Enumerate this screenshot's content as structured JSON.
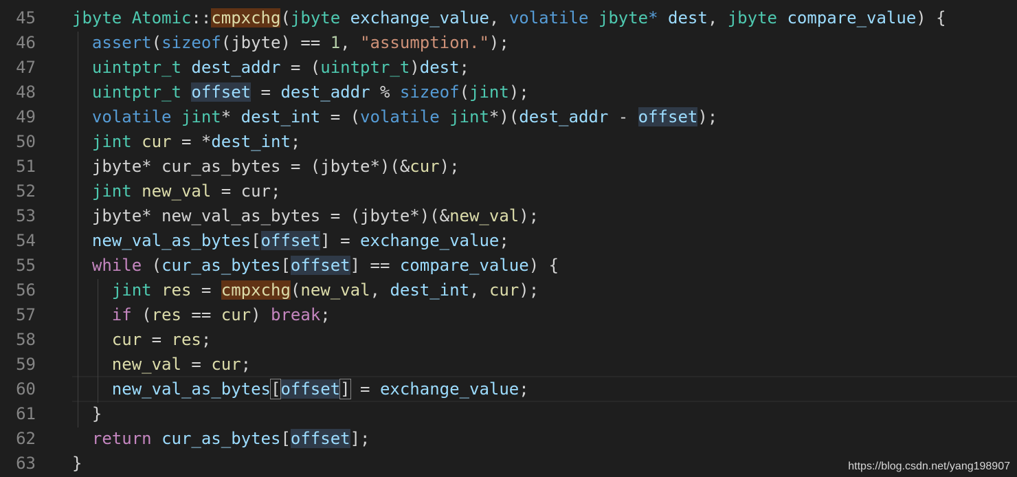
{
  "editor": {
    "lines": [
      {
        "num": "45",
        "tokens": [
          {
            "text": "jbyte ",
            "cls": "t-type"
          },
          {
            "text": "Atomic",
            "cls": "t-type"
          },
          {
            "text": "::",
            "cls": "t-plain"
          },
          {
            "text": "cmpxchg",
            "cls": "t-fn",
            "hl": "hl-sym"
          },
          {
            "text": "(",
            "cls": "t-plain"
          },
          {
            "text": "jbyte ",
            "cls": "t-type"
          },
          {
            "text": "exchange_value",
            "cls": "t-var"
          },
          {
            "text": ", ",
            "cls": "t-plain"
          },
          {
            "text": "volatile ",
            "cls": "t-kw"
          },
          {
            "text": "jbyte",
            "cls": "t-type"
          },
          {
            "text": "* ",
            "cls": "t-kw"
          },
          {
            "text": "dest",
            "cls": "t-var"
          },
          {
            "text": ", ",
            "cls": "t-plain"
          },
          {
            "text": "jbyte ",
            "cls": "t-type"
          },
          {
            "text": "compare_value",
            "cls": "t-var"
          },
          {
            "text": ") {",
            "cls": "t-plain"
          }
        ]
      },
      {
        "num": "46",
        "tokens": [
          {
            "text": "  ",
            "cls": "t-plain"
          },
          {
            "text": "assert",
            "cls": "t-kw"
          },
          {
            "text": "(",
            "cls": "t-plain"
          },
          {
            "text": "sizeof",
            "cls": "t-kw"
          },
          {
            "text": "(jbyte) == ",
            "cls": "t-plain"
          },
          {
            "text": "1",
            "cls": "t-num"
          },
          {
            "text": ", ",
            "cls": "t-plain"
          },
          {
            "text": "\"assumption.\"",
            "cls": "t-str"
          },
          {
            "text": ");",
            "cls": "t-plain"
          }
        ]
      },
      {
        "num": "47",
        "tokens": [
          {
            "text": "  ",
            "cls": "t-plain"
          },
          {
            "text": "uintptr_t ",
            "cls": "t-type"
          },
          {
            "text": "dest_addr",
            "cls": "t-var"
          },
          {
            "text": " = (",
            "cls": "t-plain"
          },
          {
            "text": "uintptr_t",
            "cls": "t-type"
          },
          {
            "text": ")",
            "cls": "t-plain"
          },
          {
            "text": "dest",
            "cls": "t-var"
          },
          {
            "text": ";",
            "cls": "t-plain"
          }
        ]
      },
      {
        "num": "48",
        "tokens": [
          {
            "text": "  ",
            "cls": "t-plain"
          },
          {
            "text": "uintptr_t ",
            "cls": "t-type"
          },
          {
            "text": "offset",
            "cls": "t-var",
            "hl": "hl-word"
          },
          {
            "text": " = ",
            "cls": "t-plain"
          },
          {
            "text": "dest_addr",
            "cls": "t-var"
          },
          {
            "text": " % ",
            "cls": "t-plain"
          },
          {
            "text": "sizeof",
            "cls": "t-kw"
          },
          {
            "text": "(",
            "cls": "t-plain"
          },
          {
            "text": "jint",
            "cls": "t-type"
          },
          {
            "text": ");",
            "cls": "t-plain"
          }
        ]
      },
      {
        "num": "49",
        "tokens": [
          {
            "text": "  ",
            "cls": "t-plain"
          },
          {
            "text": "volatile ",
            "cls": "t-kw"
          },
          {
            "text": "jint",
            "cls": "t-type"
          },
          {
            "text": "* ",
            "cls": "t-plain"
          },
          {
            "text": "dest_int",
            "cls": "t-var"
          },
          {
            "text": " = (",
            "cls": "t-plain"
          },
          {
            "text": "volatile ",
            "cls": "t-kw"
          },
          {
            "text": "jint",
            "cls": "t-type"
          },
          {
            "text": "*)(",
            "cls": "t-plain"
          },
          {
            "text": "dest_addr",
            "cls": "t-var"
          },
          {
            "text": " - ",
            "cls": "t-plain"
          },
          {
            "text": "offset",
            "cls": "t-var",
            "hl": "hl-word"
          },
          {
            "text": ");",
            "cls": "t-plain"
          }
        ]
      },
      {
        "num": "50",
        "tokens": [
          {
            "text": "  ",
            "cls": "t-plain"
          },
          {
            "text": "jint ",
            "cls": "t-type"
          },
          {
            "text": "cur",
            "cls": "t-fn"
          },
          {
            "text": " = *",
            "cls": "t-plain"
          },
          {
            "text": "dest_int",
            "cls": "t-var"
          },
          {
            "text": ";",
            "cls": "t-plain"
          }
        ]
      },
      {
        "num": "51",
        "tokens": [
          {
            "text": "  ",
            "cls": "t-plain"
          },
          {
            "text": "jbyte* cur_as_bytes = (jbyte*)(&",
            "cls": "t-plain"
          },
          {
            "text": "cur",
            "cls": "t-fn"
          },
          {
            "text": ");",
            "cls": "t-plain"
          }
        ]
      },
      {
        "num": "52",
        "tokens": [
          {
            "text": "  ",
            "cls": "t-plain"
          },
          {
            "text": "jint ",
            "cls": "t-type"
          },
          {
            "text": "new_val",
            "cls": "t-fn"
          },
          {
            "text": " = cur;",
            "cls": "t-plain"
          }
        ]
      },
      {
        "num": "53",
        "tokens": [
          {
            "text": "  ",
            "cls": "t-plain"
          },
          {
            "text": "jbyte* new_val_as_bytes = (jbyte*)(&",
            "cls": "t-plain"
          },
          {
            "text": "new_val",
            "cls": "t-fn"
          },
          {
            "text": ");",
            "cls": "t-plain"
          }
        ]
      },
      {
        "num": "54",
        "tokens": [
          {
            "text": "  ",
            "cls": "t-plain"
          },
          {
            "text": "new_val_as_bytes",
            "cls": "t-var"
          },
          {
            "text": "[",
            "cls": "t-plain"
          },
          {
            "text": "offset",
            "cls": "t-var",
            "hl": "hl-word"
          },
          {
            "text": "] = ",
            "cls": "t-plain"
          },
          {
            "text": "exchange_value",
            "cls": "t-var"
          },
          {
            "text": ";",
            "cls": "t-plain"
          }
        ]
      },
      {
        "num": "55",
        "tokens": [
          {
            "text": "  ",
            "cls": "t-plain"
          },
          {
            "text": "while",
            "cls": "t-ctrl"
          },
          {
            "text": " (",
            "cls": "t-plain"
          },
          {
            "text": "cur_as_bytes",
            "cls": "t-var"
          },
          {
            "text": "[",
            "cls": "t-plain"
          },
          {
            "text": "offset",
            "cls": "t-var",
            "hl": "hl-word"
          },
          {
            "text": "] == ",
            "cls": "t-plain"
          },
          {
            "text": "compare_value",
            "cls": "t-var"
          },
          {
            "text": ") {",
            "cls": "t-plain"
          }
        ]
      },
      {
        "num": "56",
        "tokens": [
          {
            "text": "    ",
            "cls": "t-plain"
          },
          {
            "text": "jint ",
            "cls": "t-type"
          },
          {
            "text": "res",
            "cls": "t-fn"
          },
          {
            "text": " = ",
            "cls": "t-plain"
          },
          {
            "text": "cmpxchg",
            "cls": "t-fn",
            "hl": "hl-sym"
          },
          {
            "text": "(",
            "cls": "t-plain"
          },
          {
            "text": "new_val",
            "cls": "t-fn"
          },
          {
            "text": ", ",
            "cls": "t-plain"
          },
          {
            "text": "dest_int",
            "cls": "t-var"
          },
          {
            "text": ", ",
            "cls": "t-plain"
          },
          {
            "text": "cur",
            "cls": "t-fn"
          },
          {
            "text": ");",
            "cls": "t-plain"
          }
        ]
      },
      {
        "num": "57",
        "tokens": [
          {
            "text": "    ",
            "cls": "t-plain"
          },
          {
            "text": "if",
            "cls": "t-ctrl"
          },
          {
            "text": " (",
            "cls": "t-plain"
          },
          {
            "text": "res",
            "cls": "t-fn"
          },
          {
            "text": " == ",
            "cls": "t-plain"
          },
          {
            "text": "cur",
            "cls": "t-fn"
          },
          {
            "text": ") ",
            "cls": "t-plain"
          },
          {
            "text": "break",
            "cls": "t-ctrl"
          },
          {
            "text": ";",
            "cls": "t-plain"
          }
        ]
      },
      {
        "num": "58",
        "tokens": [
          {
            "text": "    ",
            "cls": "t-plain"
          },
          {
            "text": "cur",
            "cls": "t-fn"
          },
          {
            "text": " = ",
            "cls": "t-plain"
          },
          {
            "text": "res",
            "cls": "t-fn"
          },
          {
            "text": ";",
            "cls": "t-plain"
          }
        ]
      },
      {
        "num": "59",
        "tokens": [
          {
            "text": "    ",
            "cls": "t-plain"
          },
          {
            "text": "new_val",
            "cls": "t-fn"
          },
          {
            "text": " = ",
            "cls": "t-plain"
          },
          {
            "text": "cur",
            "cls": "t-fn"
          },
          {
            "text": ";",
            "cls": "t-plain"
          }
        ]
      },
      {
        "num": "60",
        "tokens": [
          {
            "text": "    ",
            "cls": "t-plain"
          },
          {
            "text": "new_val_as_bytes",
            "cls": "t-var"
          },
          {
            "text": "[",
            "cls": "t-plain",
            "hl": "hl-bracket"
          },
          {
            "text": "offset",
            "cls": "t-var",
            "hl": "hl-word"
          },
          {
            "text": "]",
            "cls": "t-plain",
            "hl": "hl-bracket"
          },
          {
            "text": " = ",
            "cls": "t-plain"
          },
          {
            "text": "exchange_value",
            "cls": "t-var"
          },
          {
            "text": ";",
            "cls": "t-plain"
          }
        ]
      },
      {
        "num": "61",
        "tokens": [
          {
            "text": "  }",
            "cls": "t-plain"
          }
        ]
      },
      {
        "num": "62",
        "tokens": [
          {
            "text": "  ",
            "cls": "t-plain"
          },
          {
            "text": "return",
            "cls": "t-ctrl"
          },
          {
            "text": " ",
            "cls": "t-plain"
          },
          {
            "text": "cur_as_bytes",
            "cls": "t-var"
          },
          {
            "text": "[",
            "cls": "t-plain"
          },
          {
            "text": "offset",
            "cls": "t-var",
            "hl": "hl-word"
          },
          {
            "text": "];",
            "cls": "t-plain"
          }
        ]
      },
      {
        "num": "63",
        "tokens": [
          {
            "text": "}",
            "cls": "t-plain"
          }
        ]
      }
    ]
  },
  "watermark": {
    "text": "https://blog.csdn.net/yang198907"
  }
}
